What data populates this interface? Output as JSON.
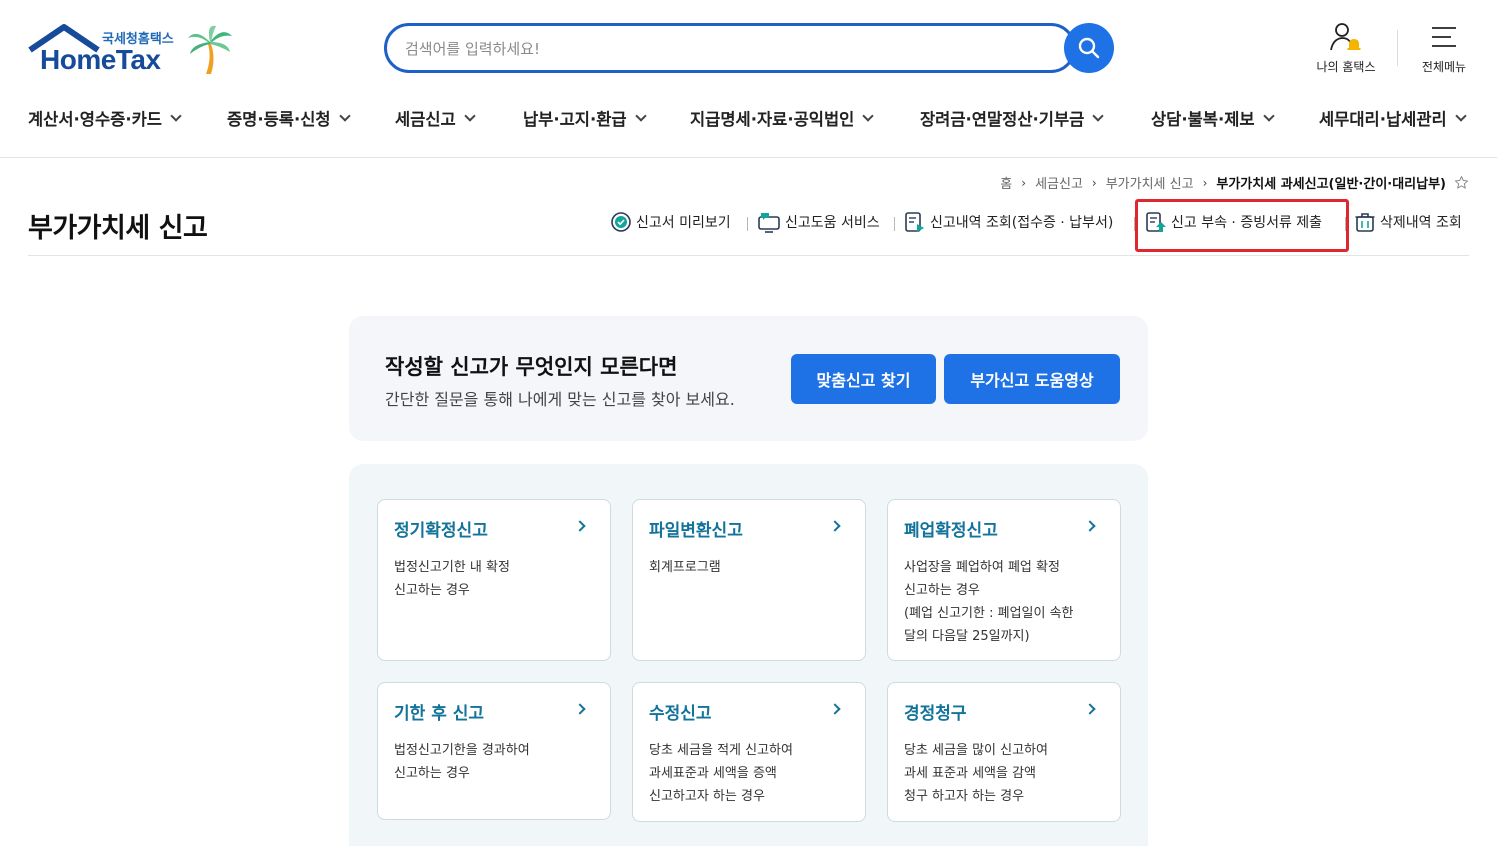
{
  "header": {
    "logo_sub": "국세청홈택스",
    "logo_main": "HomeTax",
    "search_placeholder": "검색어를 입력하세요!",
    "my_hometax": "나의 홈택스",
    "all_menu": "전체메뉴"
  },
  "gnb": [
    "계산서·영수증·카드",
    "증명·등록·신청",
    "세금신고",
    "납부·고지·환급",
    "지급명세·자료·공익법인",
    "장려금·연말정산·기부금",
    "상담·불복·제보",
    "세무대리·납세관리"
  ],
  "breadcrumb": [
    "홈",
    "세금신고",
    "부가가치세 신고",
    "부가가치세 과세신고(일반·간이·대리납부)"
  ],
  "page_title": "부가가치세 신고",
  "quick_links": [
    "신고서 미리보기",
    "신고도움 서비스",
    "신고내역 조회(접수증 · 납부서)",
    "신고 부속 · 증빙서류 제출",
    "삭제내역 조회"
  ],
  "promo": {
    "title": "작성할 신고가 무엇인지 모른다면",
    "desc": "간단한 질문을 통해 나에게 맞는 신고를 찾아 보세요.",
    "btn_find": "맞춤신고 찾기",
    "btn_video": "부가신고 도움영상"
  },
  "cards": [
    {
      "title": "정기확정신고",
      "lines": [
        "법정신고기한 내 확정",
        "신고하는 경우"
      ]
    },
    {
      "title": "파일변환신고",
      "lines": [
        "회계프로그램"
      ]
    },
    {
      "title": "폐업확정신고",
      "lines": [
        "사업장을 폐업하여 폐업 확정",
        "신고하는 경우",
        "(폐업 신고기한 : 폐업일이 속한",
        "달의 다음달 25일까지)"
      ]
    },
    {
      "title": "기한 후 신고",
      "lines": [
        "법정신고기한을 경과하여",
        "신고하는 경우"
      ]
    },
    {
      "title": "수정신고",
      "lines": [
        "당초 세금을 적게 신고하여",
        "과세표준과 세액을 증액",
        "신고하고자 하는 경우"
      ]
    },
    {
      "title": "경정청구",
      "lines": [
        "당초 세금을 많이 신고하여",
        "과세 표준과 세액을 감액",
        "청구 하고자 하는 경우"
      ]
    }
  ]
}
